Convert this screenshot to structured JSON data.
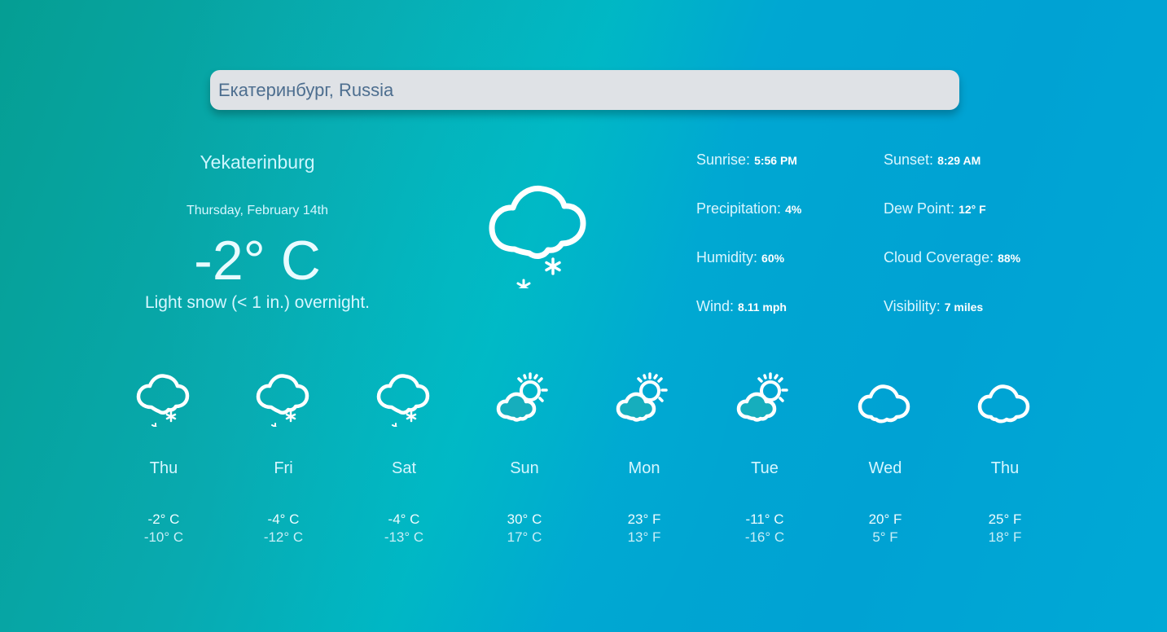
{
  "search": {
    "value": "Екатеринбург, Russia"
  },
  "current": {
    "city": "Yekaterinburg",
    "date": "Thursday, February 14th",
    "temperature": "-2° C",
    "summary": "Light snow (< 1 in.) overnight.",
    "icon": "snow-cloud-icon"
  },
  "details": {
    "sunrise": {
      "label": "Sunrise:",
      "value": "5:56 PM"
    },
    "sunset": {
      "label": "Sunset:",
      "value": "8:29 AM"
    },
    "precipitation": {
      "label": "Precipitation:",
      "value": "4%"
    },
    "dew_point": {
      "label": "Dew Point:",
      "value": "12° F"
    },
    "humidity": {
      "label": "Humidity:",
      "value": "60%"
    },
    "cloud_coverage": {
      "label": "Cloud Coverage:",
      "value": "88%"
    },
    "wind": {
      "label": "Wind:",
      "value": "8.11 mph"
    },
    "visibility": {
      "label": "Visibility:",
      "value": "7 miles"
    }
  },
  "forecast": [
    {
      "day": "Thu",
      "high": "-2° C",
      "low": "-10° C",
      "icon": "snow-cloud-icon"
    },
    {
      "day": "Fri",
      "high": "-4° C",
      "low": "-12° C",
      "icon": "snow-cloud-icon"
    },
    {
      "day": "Sat",
      "high": "-4° C",
      "low": "-13° C",
      "icon": "snow-cloud-icon"
    },
    {
      "day": "Sun",
      "high": "30° C",
      "low": "17° C",
      "icon": "partly-cloudy-icon"
    },
    {
      "day": "Mon",
      "high": "23° F",
      "low": "13° F",
      "icon": "partly-cloudy-icon"
    },
    {
      "day": "Tue",
      "high": "-11° C",
      "low": "-16° C",
      "icon": "partly-cloudy-icon"
    },
    {
      "day": "Wed",
      "high": "20° F",
      "low": "5° F",
      "icon": "cloud-icon"
    },
    {
      "day": "Thu",
      "high": "25° F",
      "low": "18° F",
      "icon": "cloud-icon"
    }
  ],
  "colors": {
    "background_start": "#059e93",
    "background_end": "#00a2d3",
    "search_background": "#dfe2e6",
    "search_text": "#4d6e8f"
  }
}
